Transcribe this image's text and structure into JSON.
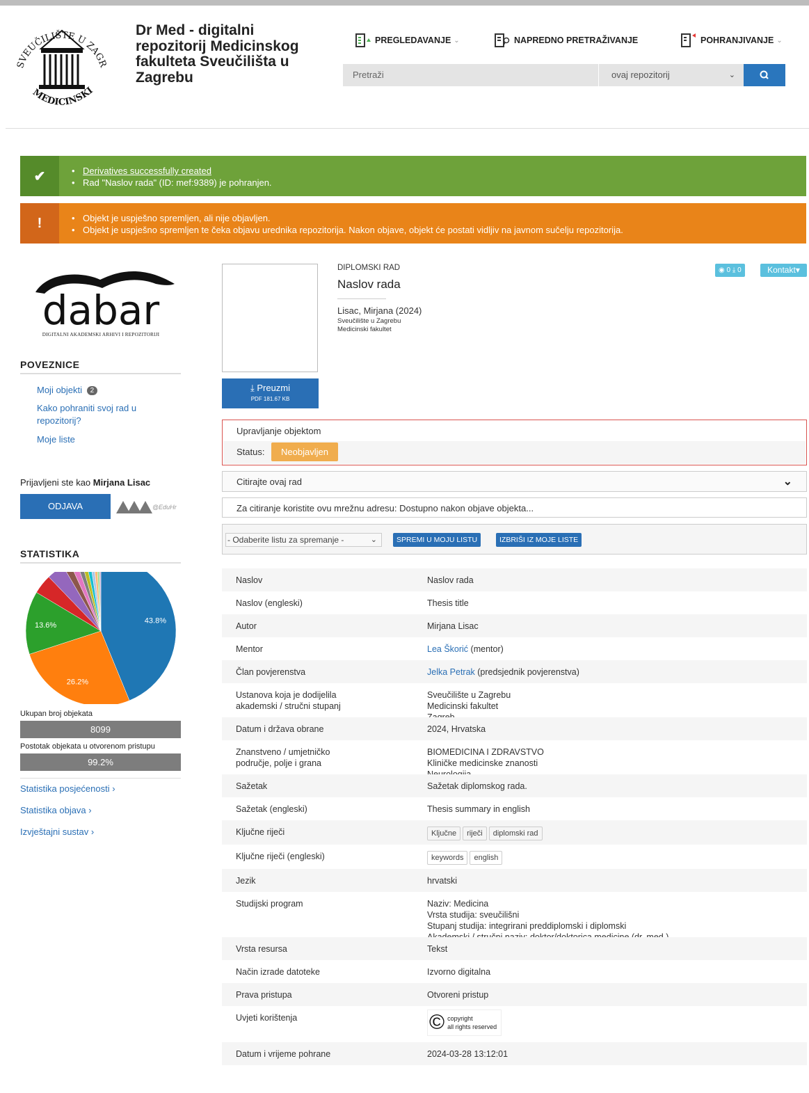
{
  "header": {
    "site_title": "Dr Med - digitalni repozitorij Medicinskog fakulteta Sveučilišta u Zagrebu",
    "seal_text": "SVEUČILIŠTE U ZAGREBU MEDICINSKI FAKULTET",
    "nav": [
      {
        "label": "PREGLEDAVANJE",
        "icon": "browse-icon",
        "has_dropdown": true
      },
      {
        "label": "NAPREDNO PRETRAŽIVANJE",
        "icon": "advanced-search-icon",
        "has_dropdown": false
      },
      {
        "label": "POHRANJIVANJE",
        "icon": "deposit-icon",
        "has_dropdown": true
      }
    ],
    "search": {
      "placeholder": "Pretraži",
      "scope": "ovaj repozitorij"
    }
  },
  "alerts": {
    "success": [
      "Derivatives successfully created",
      "Rad \"Naslov rada\" (ID: mef:9389) je pohranjen."
    ],
    "warning": [
      "Objekt je uspješno spremljen, ali nije objavljen.",
      "Objekt je uspješno spremljen te čeka objavu urednika repozitorija. Nakon objave, objekt će postati vidljiv na javnom sučelju repozitorija."
    ]
  },
  "sidebar": {
    "dabar_logo_text": "dabar",
    "dabar_subtitle": "DIGITALNI AKADEMSKI ARHIVI I REPOZITORIJI",
    "links_title": "POVEZNICE",
    "links": [
      {
        "label": "Moji objekti",
        "badge": "2"
      },
      {
        "label": "Kako pohraniti svoj rad u repozitorij?"
      },
      {
        "label": "Moje liste"
      }
    ],
    "logged_in_prefix": "Prijavljeni ste kao",
    "logged_in_user": "Mirjana Lisac",
    "logout_label": "ODJAVA",
    "eduhr_label": "@EduHr",
    "stats_title": "STATISTIKA",
    "total_label": "Ukupan broj objekata",
    "total_value": "8099",
    "open_label": "Postotak objekata u otvorenom pristupu",
    "open_value": "99.2%",
    "stat_links": [
      "Statistika posjećenosti ›",
      "Statistika objava ›",
      "Izvještajni sustav ›"
    ]
  },
  "chart_data": {
    "type": "pie",
    "slices": [
      {
        "value": 43.8,
        "label": "43.8%",
        "color": "#1f77b4"
      },
      {
        "value": 26.2,
        "label": "26.2%",
        "color": "#ff7f0e"
      },
      {
        "value": 13.6,
        "label": "13.6%",
        "color": "#2ca02c"
      },
      {
        "value": 4.2,
        "label": "",
        "color": "#d62728"
      },
      {
        "value": 3.8,
        "label": "",
        "color": "#9467bd"
      },
      {
        "value": 1.6,
        "label": "",
        "color": "#8c564b"
      },
      {
        "value": 1.4,
        "label": "",
        "color": "#e377c2"
      },
      {
        "value": 1.1,
        "label": "",
        "color": "#7f7f7f"
      },
      {
        "value": 1.0,
        "label": "",
        "color": "#bcbd22"
      },
      {
        "value": 0.9,
        "label": "",
        "color": "#17becf"
      },
      {
        "value": 0.8,
        "label": "",
        "color": "#aec7e8"
      },
      {
        "value": 0.7,
        "label": "",
        "color": "#ffbb78"
      },
      {
        "value": 0.5,
        "label": "",
        "color": "#98df8a"
      },
      {
        "value": 0.4,
        "label": "",
        "color": "#c5b0d5"
      }
    ]
  },
  "record": {
    "type_label": "DIPLOMSKI RAD",
    "title": "Naslov rada",
    "author_line": "Lisac, Mirjana (2024)",
    "institution_1": "Sveučilište u Zagrebu",
    "institution_2": "Medicinski fakultet",
    "views": "0",
    "downloads": "0",
    "contact_label": "Kontakt",
    "download_label": "Preuzmi",
    "download_meta": "PDF 181.67 KB",
    "manage_title": "Upravljanje objektom",
    "status_label": "Status:",
    "status_value": "Neobjavljen",
    "cite_title": "Citirajte ovaj rad",
    "cite_url_text": "Za citiranje koristite ovu mrežnu adresu: Dostupno nakon objave objekta...",
    "list_select": "- Odaberite listu za spremanje -",
    "save_list_label": "SPREMI U MOJU LISTU",
    "delete_list_label": "IZBRIŠI IZ MOJE LISTE"
  },
  "metadata": {
    "rows": [
      {
        "key": "Naslov",
        "lines": [
          "Naslov rada"
        ]
      },
      {
        "key": "Naslov (engleski)",
        "lines": [
          "Thesis title"
        ]
      },
      {
        "key": "Autor",
        "lines": [
          "Mirjana Lisac"
        ]
      },
      {
        "key": "Mentor",
        "link": "Lea Škorić",
        "rest": " (mentor)"
      },
      {
        "key": "Član povjerenstva",
        "link": "Jelka Petrak",
        "rest": " (predsjednik povjerenstva)"
      },
      {
        "key_lines": [
          "Ustanova koja je dodijelila",
          "akademski / stručni stupanj"
        ],
        "lines": [
          "Sveučilište u Zagrebu",
          "Medicinski fakultet",
          "Zagreb"
        ]
      },
      {
        "key": "Datum i država obrane",
        "lines": [
          "2024, Hrvatska"
        ]
      },
      {
        "key_lines": [
          "Znanstveno / umjetničko",
          "područje, polje i grana"
        ],
        "lines": [
          "BIOMEDICINA I ZDRAVSTVO",
          "Kliničke medicinske znanosti",
          "Neurologija"
        ]
      },
      {
        "key": "Sažetak",
        "lines": [
          "Sažetak diplomskog rada."
        ]
      },
      {
        "key": "Sažetak (engleski)",
        "lines": [
          "Thesis summary in english"
        ]
      },
      {
        "key": "Ključne riječi",
        "tags": [
          "Ključne",
          "riječi",
          "diplomski rad"
        ]
      },
      {
        "key": "Ključne riječi (engleski)",
        "tags": [
          "keywords",
          "english"
        ]
      },
      {
        "key": "Jezik",
        "lines": [
          "hrvatski"
        ]
      },
      {
        "key": "Studijski program",
        "lines": [
          "Naziv: Medicina",
          "Vrsta studija: sveučilišni",
          "Stupanj studija: integrirani preddiplomski i diplomski",
          "Akademski / stručni naziv: doktor/doktorica medicine (dr. med.)"
        ]
      },
      {
        "key": "Vrsta resursa",
        "lines": [
          "Tekst"
        ]
      },
      {
        "key": "Način izrade datoteke",
        "lines": [
          "Izvorno digitalna"
        ]
      },
      {
        "key": "Prava pristupa",
        "lines": [
          "Otvoreni pristup"
        ]
      },
      {
        "key": "Uvjeti korištenja",
        "copyright": [
          "copyright",
          "all rights reserved"
        ]
      },
      {
        "key": "Datum i vrijeme pohrane",
        "lines": [
          "2024-03-28 13:12:01"
        ]
      }
    ]
  }
}
